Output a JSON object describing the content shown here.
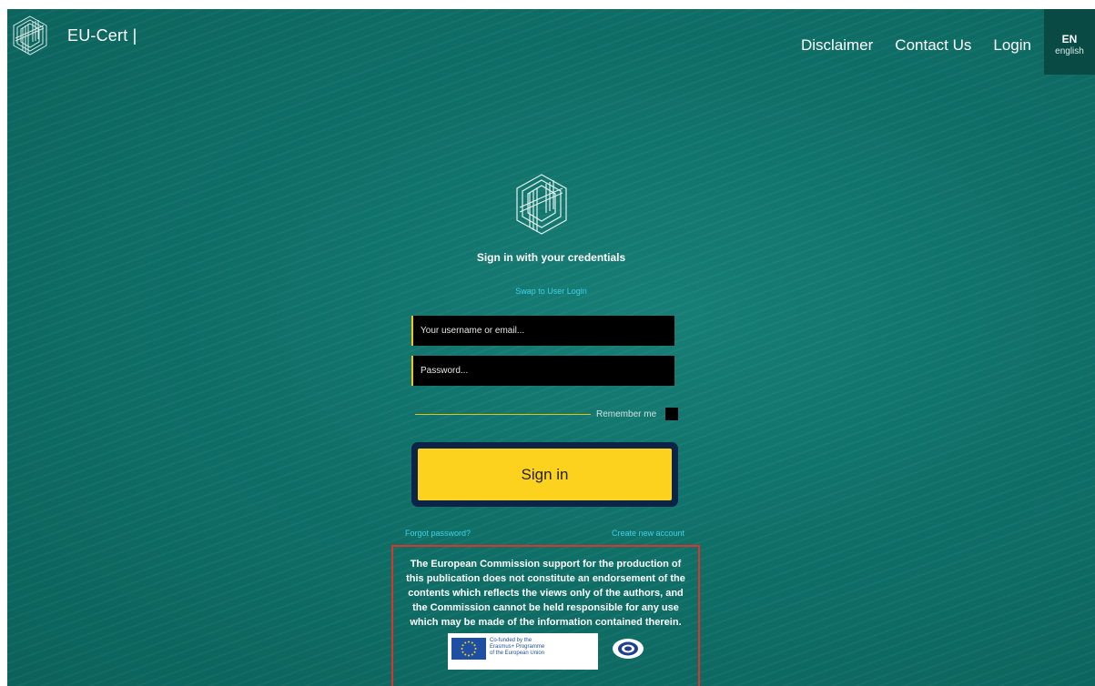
{
  "header": {
    "brand": "EU-Cert |",
    "nav": {
      "disclaimer": "Disclaimer",
      "contact": "Contact Us",
      "login": "Login"
    },
    "language": {
      "code": "EN",
      "name": "english"
    }
  },
  "login": {
    "title": "Sign in with your credentials",
    "swap_link": "Swap to User Login",
    "username_placeholder": "Your username or email...",
    "password_placeholder": "Password...",
    "remember_label": "Remember me",
    "submit_label": "Sign in",
    "forgot_link": "Forgot password?",
    "create_link": "Create new account"
  },
  "disclaimer": {
    "text": "The European Commission support for the production of this publication does not constitute an endorsement of the contents which reflects the views only of the authors, and the Commission cannot be held responsible for any use which may be made of the information contained therein.",
    "eu_badge_lines": [
      "Co-funded by the",
      "Erasmus+ Programme",
      "of the European Union"
    ]
  },
  "colors": {
    "background": "#0f7068",
    "accent_yellow": "#fdd21f",
    "link_cyan": "#3fcfe6",
    "disclaimer_border": "#e0312b",
    "language_bg": "#0a4a45"
  },
  "icons": {
    "brand_logo": "eu-cert-cube-logo-icon",
    "center_logo": "eu-cert-cube-logo-icon",
    "eu_flag": "eu-flag-icon",
    "partner_logo": "partner-seal-icon"
  }
}
